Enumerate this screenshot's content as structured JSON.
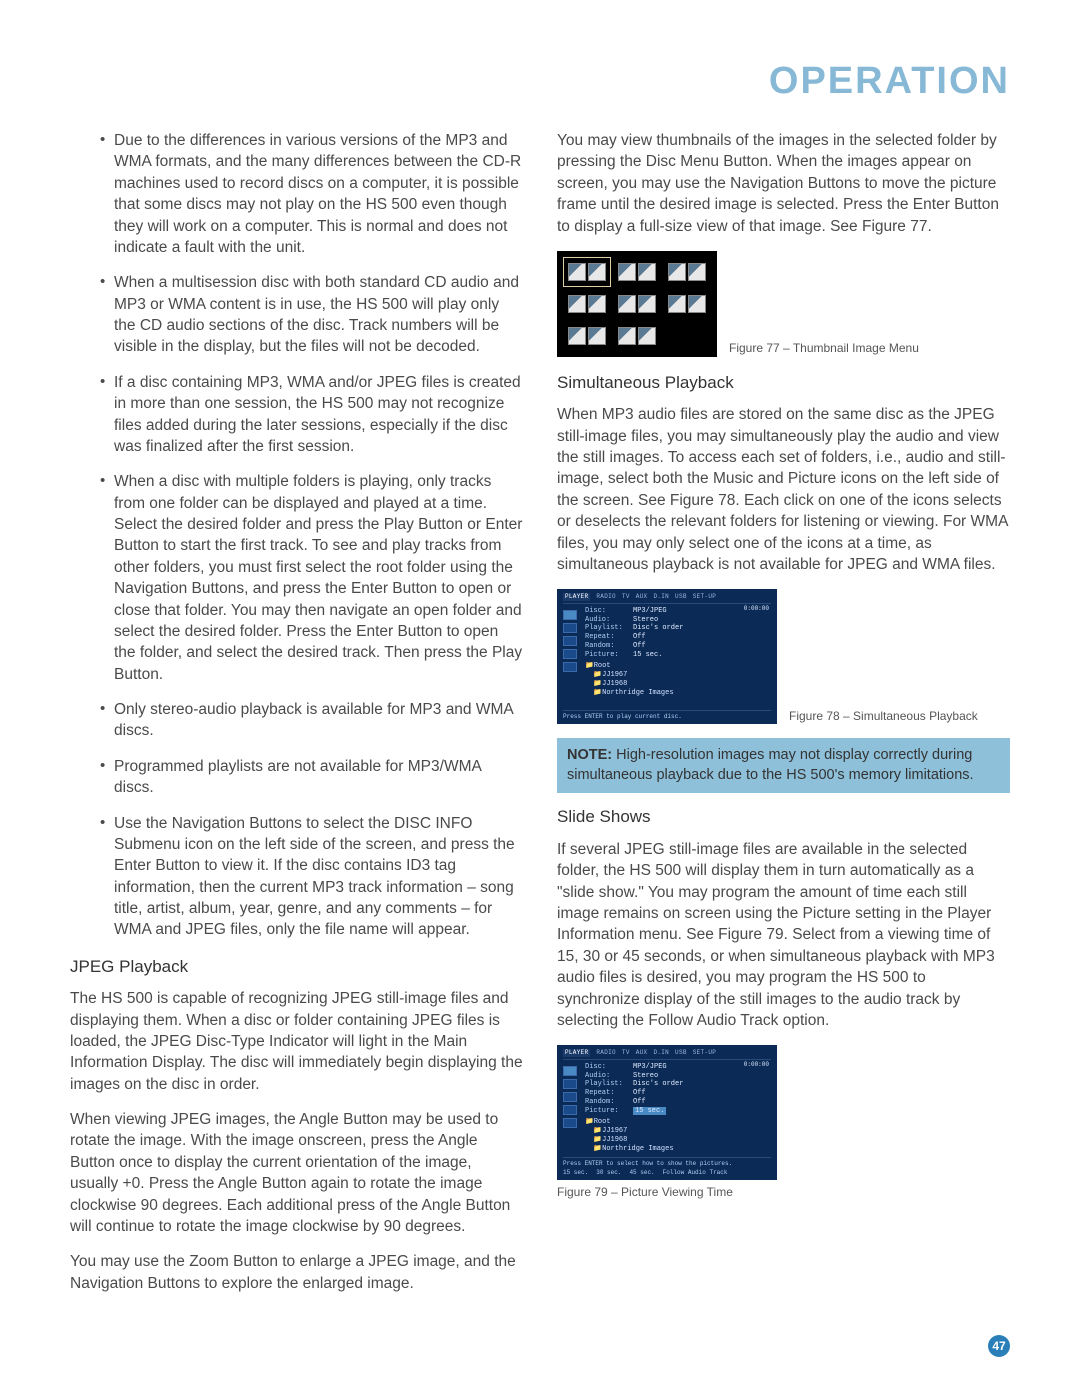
{
  "header": "OPERATION",
  "page_number": "47",
  "left": {
    "bullets": [
      "Due to the differences in various versions of the MP3 and WMA formats, and the many differences between the CD-R machines used to record discs on a computer, it is possible that some discs may not play on the HS 500 even though they will work on a computer. This is normal and does not indicate a fault with the unit.",
      "When a multisession disc with both standard CD audio and MP3 or WMA content is in use, the HS 500 will play only the CD audio sections of the disc. Track numbers will be visible in the display, but the files will not be decoded.",
      "If a disc containing MP3, WMA and/or JPEG files is created in more than one session, the HS 500 may not recognize files added during the later sessions, especially if the disc was finalized after the first session.",
      "When a disc with multiple folders is playing, only tracks from one folder can be displayed and played at a time. Select the desired folder and press the Play Button or Enter Button to start the first track. To see and play tracks from other folders, you must first select the root folder using the Navigation Buttons, and press the Enter Button to open or close that folder. You may then navigate an open folder and select the desired folder. Press the Enter Button to open the folder, and select the desired track. Then press the Play Button.",
      "Only stereo-audio playback is available for MP3 and WMA discs.",
      "Programmed playlists are not available for MP3/WMA discs.",
      "Use the Navigation Buttons to select the DISC INFO Submenu icon on the left side of the screen, and press the Enter Button to view it. If the disc contains ID3 tag information, then the current MP3 track information – song title, artist, album, year, genre, and any comments – for WMA and JPEG files, only the file name will appear."
    ],
    "h_jpeg": "JPEG Playback",
    "jpeg_p1": "The HS 500 is capable of recognizing JPEG still-image files and displaying them. When a disc or folder containing JPEG files is loaded, the JPEG Disc-Type Indicator will light in the Main Information Display. The disc will immediately begin displaying the images on the disc in order.",
    "jpeg_p2": "When viewing JPEG images, the Angle Button may be used to rotate the image. With the image onscreen, press the Angle Button once to display the current orientation of the image, usually +0. Press the Angle Button again to rotate the image clockwise 90 degrees. Each additional press of the Angle Button will continue to rotate the image clockwise by 90 degrees.",
    "jpeg_p3": "You may use the Zoom Button to enlarge a JPEG image, and the Navigation Buttons to explore the enlarged image."
  },
  "right": {
    "p_thumb": "You may view thumbnails of the images in the selected folder by pressing the Disc Menu Button. When the images appear on screen, you may use the Navigation Buttons to move the picture frame until the desired image is selected. Press the Enter Button to display a full-size view of that image. See Figure 77.",
    "fig77_cap": "Figure 77 – Thumbnail Image Menu",
    "h_sim": "Simultaneous Playback",
    "p_sim": "When MP3 audio files are stored on the same disc as the JPEG still-image files, you may simultaneously play the audio and view the still images. To access each set of folders, i.e., audio and still-image, select both the Music and Picture icons on the left side of the screen. See Figure 78. Each click on one of the icons selects or deselects the relevant folders for listening or viewing. For WMA files, you may only select one of the icons at a time, as simultaneous playback is not available for JPEG and WMA files.",
    "fig78_cap": "Figure 78 – Simultaneous Playback",
    "note_label": "NOTE:",
    "note": "High-resolution images may not display correctly during simultaneous playback due to the HS 500's memory limitations.",
    "h_slide": "Slide Shows",
    "p_slide": "If several JPEG still-image files are available in the selected folder, the HS 500 will display them in turn automatically as a \"slide show.\" You may program the amount of time each still image remains on screen using the Picture setting in the Player Information menu. See Figure 79. Select from a viewing time of 15, 30 or 45 seconds, or when simultaneous playback with MP3 audio files is desired, you may program the HS 500 to synchronize display of the still images to the audio track by selecting the Follow Audio Track option.",
    "fig79_cap": "Figure 79 – Picture Viewing Time"
  },
  "screen": {
    "tabs": [
      "PLAYER",
      "RADIO",
      "TV",
      "AUX",
      "D.IN",
      "USB",
      "SET-UP"
    ],
    "time": "0:00:00",
    "info": {
      "Disc": "MP3/JPEG",
      "Audio": "Stereo",
      "Playlist": "Disc's order",
      "Repeat": "Off",
      "Random": "Off",
      "Picture": "15 sec."
    },
    "tree": [
      "Root",
      "JJ1967",
      "JJ1968",
      "Northridge Images"
    ],
    "foot78": "Press ENTER to play current disc.",
    "foot79": "Press ENTER to select how to show the pictures.",
    "foot79_opts": [
      "15 sec.",
      "30 sec.",
      "45 sec.",
      "Follow Audio Track"
    ]
  }
}
